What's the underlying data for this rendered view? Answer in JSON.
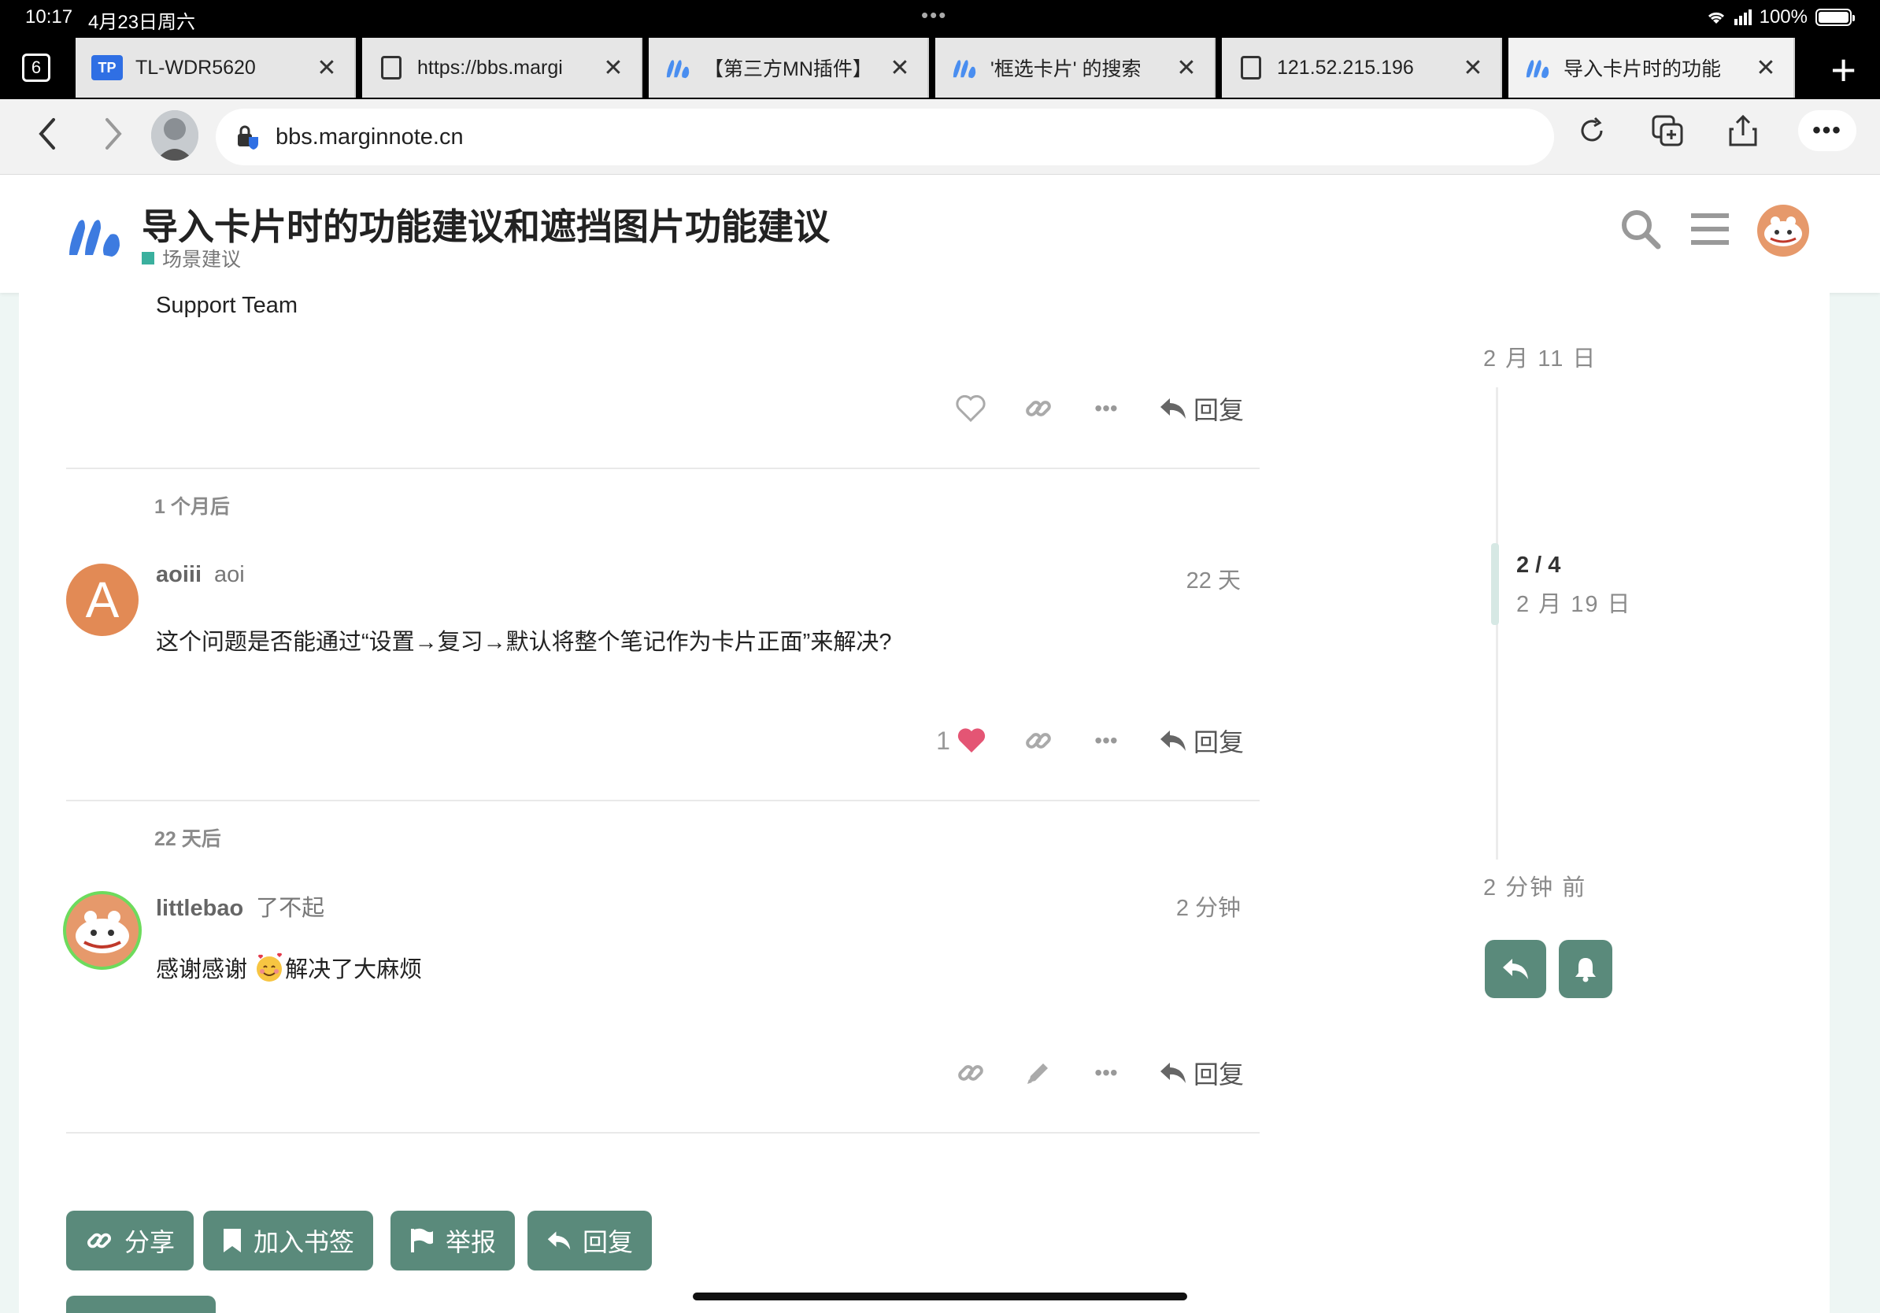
{
  "status_bar": {
    "time": "10:17",
    "date": "4月23日周六",
    "battery": "100%"
  },
  "tabs": {
    "count": "6",
    "items": [
      {
        "title": "TL-WDR5620",
        "icon": "tp-link-icon"
      },
      {
        "title": "https://bbs.margi",
        "icon": "page-icon"
      },
      {
        "title": "【第三方MN插件】",
        "icon": "marginnote-icon"
      },
      {
        "title": "'框选卡片' 的搜索",
        "icon": "marginnote-icon"
      },
      {
        "title": "121.52.215.196",
        "icon": "page-icon"
      },
      {
        "title": "导入卡片时的功能",
        "icon": "marginnote-icon"
      }
    ]
  },
  "address_bar": {
    "url": "bbs.marginnote.cn"
  },
  "header": {
    "title": "导入卡片时的功能建议和遮挡图片功能建议",
    "category": "场景建议",
    "category_color": "#3ab09e"
  },
  "posts": {
    "previous": {
      "text": "Support Team",
      "reply_label": "回复"
    },
    "gap1": "1 个月后",
    "aoiii": {
      "username": "aoiii",
      "fullname": "aoi",
      "avatar_letter": "A",
      "avatar_color": "#e28a55",
      "date": "22 天",
      "text": "这个问题是否能通过“设置→复习→默认将整个笔记作为卡片正面”来解决?",
      "like_count": "1",
      "reply_label": "回复"
    },
    "gap2": "22 天后",
    "littlebao": {
      "username": "littlebao",
      "fullname": "了不起",
      "date": "2 分钟",
      "text_before": "感谢感谢 ",
      "text_after": "解决了大麻烦",
      "reply_label": "回复"
    }
  },
  "timeline": {
    "start_date": "2 月 11 日",
    "position": "2 / 4",
    "position_date": "2 月 19 日",
    "end_date": "2 分钟 前"
  },
  "footer_buttons": {
    "share": "分享",
    "bookmark": "加入书签",
    "flag": "举报",
    "reply": "回复"
  },
  "colors": {
    "accent": "#5a8a7b",
    "like_heart": "#e45574"
  }
}
